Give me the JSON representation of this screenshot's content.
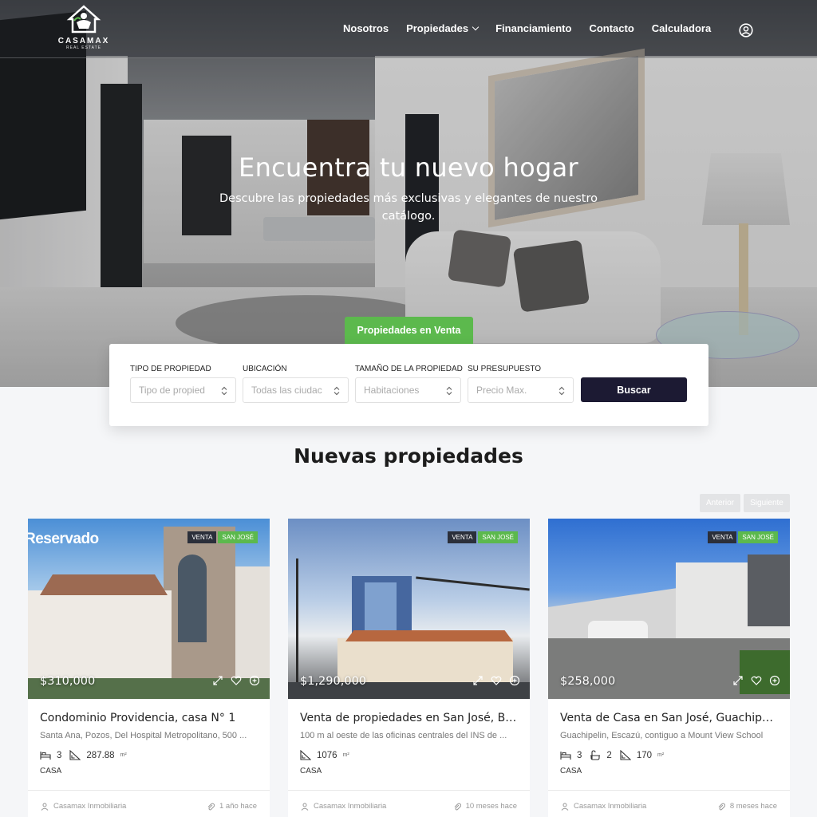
{
  "brand": {
    "name": "CASAMAX",
    "tagline": "REAL ESTATE"
  },
  "nav": {
    "items": [
      {
        "label": "Nosotros"
      },
      {
        "label": "Propiedades",
        "has_dropdown": true
      },
      {
        "label": "Financiamiento"
      },
      {
        "label": "Contacto"
      },
      {
        "label": "Calculadora"
      }
    ]
  },
  "hero": {
    "title": "Encuentra tu nuevo hogar",
    "subtitle": "Descubre las propiedades más exclusivas y elegantes de nuestro catálogo.",
    "tab": "Propiedades en Venta"
  },
  "search": {
    "fields": [
      {
        "label": "TIPO DE PROPIEDAD",
        "value": "Tipo de propied"
      },
      {
        "label": "UBICACIÓN",
        "value": "Todas las ciudac"
      },
      {
        "label": "TAMAÑO DE LA PROPIEDAD",
        "value": "Habitaciones"
      },
      {
        "label": "SU PRESUPUESTO",
        "value": "Precio Max."
      }
    ],
    "button": "Buscar"
  },
  "section": {
    "title": "Nuevas propiedades",
    "prev": "Anterior",
    "next": "Siguiente"
  },
  "colors": {
    "accent_green": "#5cb94d",
    "dark_button": "#1c1a33"
  },
  "listings": [
    {
      "overlay": "Reservado",
      "badges": [
        "VENTA",
        "SAN JOSÉ"
      ],
      "price": "$310,000",
      "title": "Condominio Providencia, casa N° 1",
      "address": "Santa Ana, Pozos, Del Hospital Metropolitano, 500 ...",
      "features": [
        {
          "icon": "bed-icon",
          "value": "3"
        },
        {
          "icon": "area-icon",
          "value": "287.88",
          "unit": "m²"
        }
      ],
      "type": "CASA",
      "agent": "Casamax Inmobiliaria",
      "time": "1 año hace"
    },
    {
      "overlay": "",
      "badges": [
        "VENTA",
        "SAN JOSÉ"
      ],
      "price": "$1,290,000",
      "title": "Venta de propiedades en San José, Ba...",
      "address": "100 m al oeste de las oficinas centrales del INS de ...",
      "features": [
        {
          "icon": "area-icon",
          "value": "1076",
          "unit": "m²"
        }
      ],
      "type": "CASA",
      "agent": "Casamax Inmobiliaria",
      "time": "10 meses hace"
    },
    {
      "overlay": "",
      "badges": [
        "VENTA",
        "SAN JOSÉ"
      ],
      "price": "$258,000",
      "title": "Venta de Casa en San José, Guachipelí...",
      "address": "Guachipelin, Escazú, contiguo a Mount View School",
      "features": [
        {
          "icon": "bed-icon",
          "value": "3"
        },
        {
          "icon": "bath-icon",
          "value": "2"
        },
        {
          "icon": "area-icon",
          "value": "170",
          "unit": "m²"
        }
      ],
      "type": "CASA",
      "agent": "Casamax Inmobiliaria",
      "time": "8 meses hace"
    }
  ]
}
